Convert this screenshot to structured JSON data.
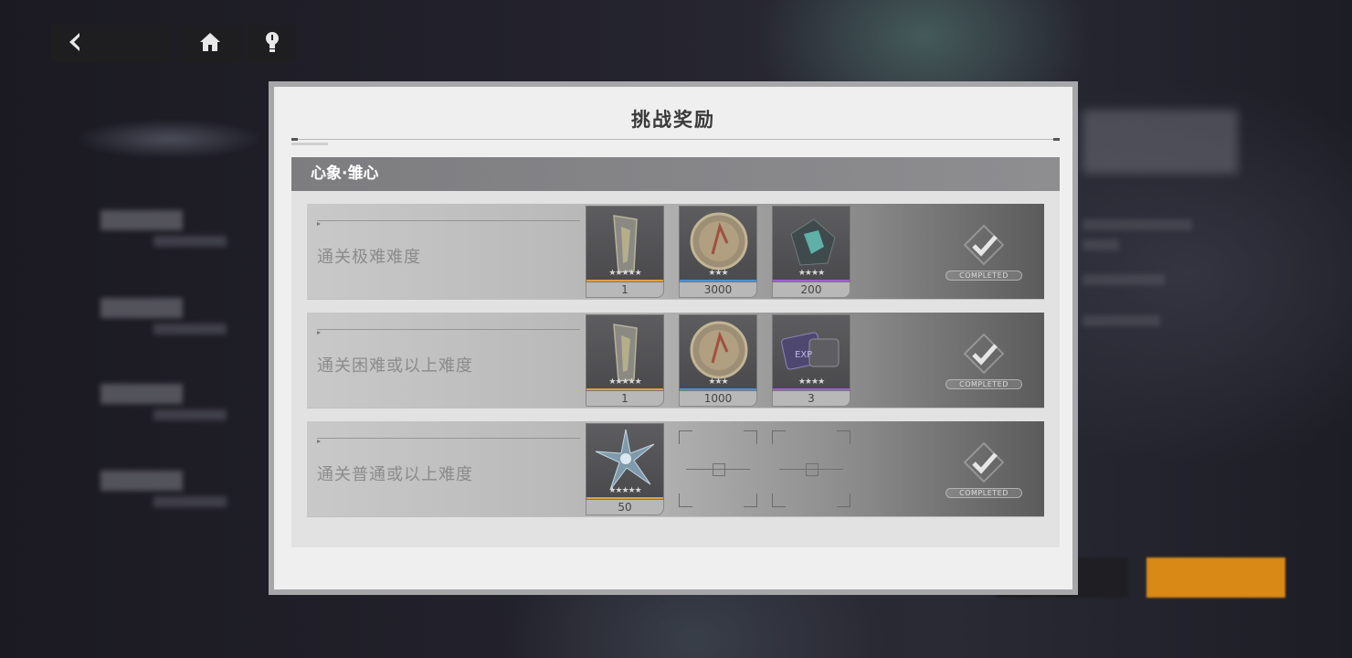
{
  "nav": {
    "back_icon": "back-arrow-icon",
    "home_icon": "home-icon",
    "hint_icon": "lightbulb-icon"
  },
  "dialog": {
    "title": "挑战奖励",
    "group_title": "心象·雏心",
    "completed_label": "COMPLETED",
    "tasks": [
      {
        "label": "通关极难难度",
        "rewards": [
          {
            "icon": "gold-figure-fragment-icon",
            "stars": "★★★★★",
            "qty": "1",
            "rarity_color": "#e0a040"
          },
          {
            "icon": "coin-icon",
            "stars": "★★★",
            "qty": "3000",
            "rarity_color": "#4d8fd6"
          },
          {
            "icon": "crystal-material-icon",
            "stars": "★★★★",
            "qty": "200",
            "rarity_color": "#a060d0"
          }
        ]
      },
      {
        "label": "通关困难或以上难度",
        "rewards": [
          {
            "icon": "gold-figure-fragment-icon",
            "stars": "★★★★★",
            "qty": "1",
            "rarity_color": "#e0a040"
          },
          {
            "icon": "coin-icon",
            "stars": "★★★",
            "qty": "1000",
            "rarity_color": "#4d8fd6"
          },
          {
            "icon": "exp-chip-icon",
            "stars": "★★★★",
            "qty": "3",
            "rarity_color": "#a060d0"
          }
        ]
      },
      {
        "label": "通关普通或以上难度",
        "rewards": [
          {
            "icon": "star-crystal-icon",
            "stars": "★★★★★",
            "qty": "50",
            "rarity_color": "#e0a040"
          }
        ]
      }
    ]
  }
}
